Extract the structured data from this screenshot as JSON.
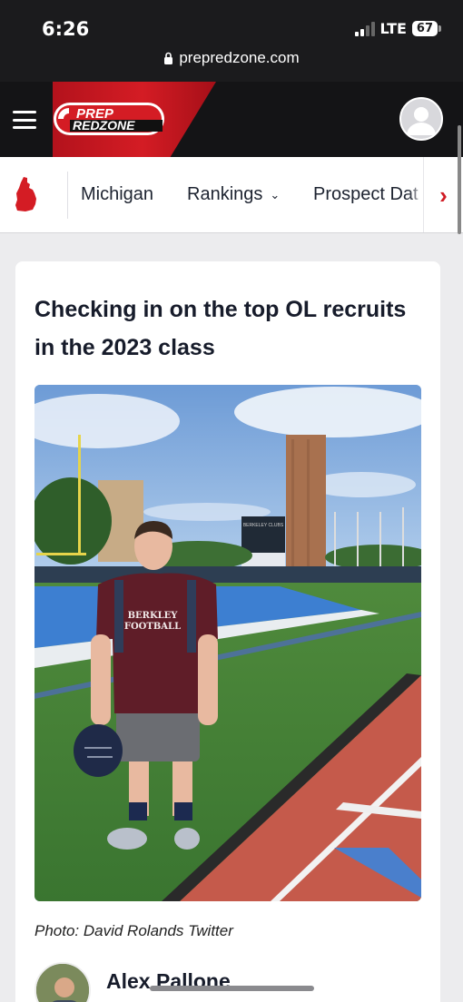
{
  "status_bar": {
    "time": "6:26",
    "network": "LTE",
    "battery": "67",
    "url": "prepredzone.com"
  },
  "header": {
    "brand_line1": "PREP",
    "brand_line2": "REDZONE",
    "brand_color": "#d41c24"
  },
  "subnav": {
    "state_icon": "michigan-state-icon",
    "items": [
      {
        "label": "Michigan"
      },
      {
        "label": "Rankings"
      },
      {
        "label": "Prospect Dat"
      }
    ],
    "next_icon": "chevron-right-icon"
  },
  "article": {
    "headline": "Checking in on the top OL recruits in the 2023 class",
    "photo_shirt_line1": "BERKLEY",
    "photo_shirt_line2": "FOOTBALL",
    "photo_board_text": "BERKELEY CLUBS",
    "caption": "Photo: David Rolands Twitter",
    "author_name": "Alex Pallone"
  }
}
